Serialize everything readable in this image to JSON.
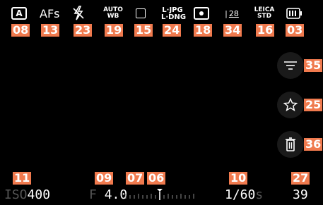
{
  "top": {
    "af_mode": "AFs",
    "wb_line1": "AUTO",
    "wb_line2": "WB",
    "format_line1": "L·JPG",
    "format_line2": "L·DNG",
    "lens_value": "28",
    "look_line1": "LEICA",
    "look_line2": "STD",
    "exposure_mode_letter": "A"
  },
  "badges": {
    "b08": "08",
    "b13": "13",
    "b23": "23",
    "b19": "19",
    "b15": "15",
    "b24": "24",
    "b18": "18",
    "b34": "34",
    "b16": "16",
    "b03": "03",
    "b35": "35",
    "b25": "25",
    "b36": "36",
    "b11": "11",
    "b09": "09",
    "b07": "07",
    "b06": "06",
    "b10": "10",
    "b27": "27"
  },
  "bottom": {
    "iso_label": "ISO",
    "iso_value": "400",
    "aperture_label": "F",
    "aperture_value": "4.0",
    "shutter_value": "1/60",
    "shutter_unit": "s",
    "shots_remaining": "39"
  },
  "icons": {
    "exposure_mode": "auto-mode-icon",
    "flash": "flash-off-icon",
    "drive": "single-shot-icon",
    "metering": "spot-metering-icon",
    "battery": "battery-icon",
    "menu": "menu-filter-icon",
    "favorite": "star-icon",
    "delete": "trash-icon"
  },
  "colors": {
    "badge": "#f07a4e",
    "background": "#000000"
  }
}
